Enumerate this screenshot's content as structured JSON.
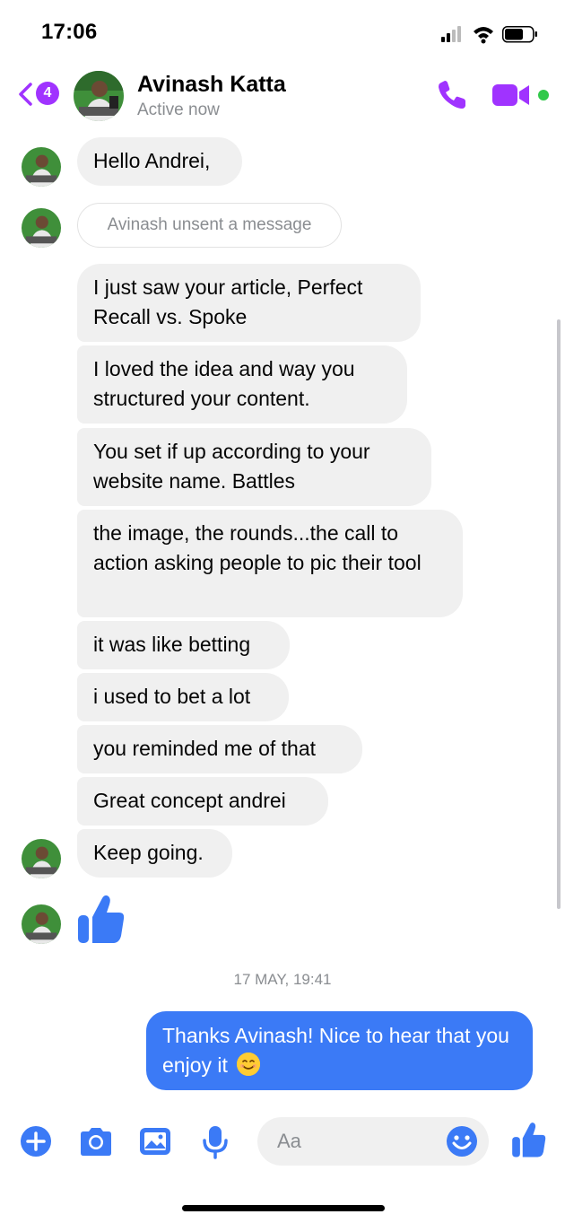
{
  "status_bar": {
    "time": "17:06"
  },
  "header": {
    "back_badge": "4",
    "contact_name": "Avinash Katta",
    "contact_status": "Active now"
  },
  "messages": [
    {
      "text": "Hello Andrei,"
    },
    {
      "text": "Avinash unsent a message"
    },
    {
      "text": "I just saw your article, Perfect Recall vs. Spoke"
    },
    {
      "text": "I loved the idea and way you structured your content."
    },
    {
      "text": "You set if up according to your website name. Battles"
    },
    {
      "text": "the image, the rounds...the call to action asking people to pic their tool"
    },
    {
      "text": "it was like betting"
    },
    {
      "text": "i used to bet a lot"
    },
    {
      "text": "you reminded me of that"
    },
    {
      "text": "Great concept andrei"
    },
    {
      "text": "Keep going."
    }
  ],
  "timestamp": "17 MAY, 19:41",
  "sent_message": {
    "text": "Thanks Avinash! Nice to hear that you enjoy it"
  },
  "composer": {
    "placeholder": "Aa"
  },
  "colors": {
    "accent_purple": "#a033ff",
    "messenger_blue": "#3b7af6",
    "bubble_gray": "#f0f0f0",
    "online_green": "#31c94a"
  }
}
